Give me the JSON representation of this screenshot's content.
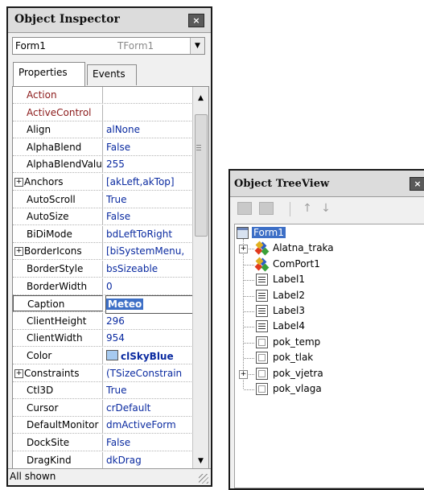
{
  "inspector": {
    "title": "Object Inspector",
    "close_label": "×",
    "object_name": "Form1",
    "object_class": "TForm1",
    "tabs": [
      "Properties",
      "Events"
    ],
    "status": "All shown",
    "properties": [
      {
        "name": "Action",
        "value": "",
        "event": true
      },
      {
        "name": "ActiveControl",
        "value": "",
        "event": true
      },
      {
        "name": "Align",
        "value": "alNone"
      },
      {
        "name": "AlphaBlend",
        "value": "False"
      },
      {
        "name": "AlphaBlendValu",
        "value": "255"
      },
      {
        "name": "Anchors",
        "value": "[akLeft,akTop]",
        "expandable": true
      },
      {
        "name": "AutoScroll",
        "value": "True"
      },
      {
        "name": "AutoSize",
        "value": "False"
      },
      {
        "name": "BiDiMode",
        "value": "bdLeftToRight"
      },
      {
        "name": "BorderIcons",
        "value": "[biSystemMenu,",
        "expandable": true
      },
      {
        "name": "BorderStyle",
        "value": "bsSizeable"
      },
      {
        "name": "BorderWidth",
        "value": "0"
      },
      {
        "name": "Caption",
        "value": "Meteo",
        "selected": true
      },
      {
        "name": "ClientHeight",
        "value": "296"
      },
      {
        "name": "ClientWidth",
        "value": "954"
      },
      {
        "name": "Color",
        "value": "clSkyBlue",
        "swatch": "#a6caf0"
      },
      {
        "name": "Constraints",
        "value": "(TSizeConstrain",
        "expandable": true
      },
      {
        "name": "Ctl3D",
        "value": "True"
      },
      {
        "name": "Cursor",
        "value": "crDefault"
      },
      {
        "name": "DefaultMonitor",
        "value": "dmActiveForm"
      },
      {
        "name": "DockSite",
        "value": "False"
      },
      {
        "name": "DragKind",
        "value": "dkDrag"
      }
    ]
  },
  "treeview": {
    "title": "Object TreeView",
    "close_label": "×",
    "nodes": [
      {
        "label": "Form1",
        "icon": "form-icon",
        "level": 0,
        "selected": true
      },
      {
        "label": "Alatna_traka",
        "icon": "component-icon",
        "level": 1,
        "expander": "+"
      },
      {
        "label": "ComPort1",
        "icon": "component-icon",
        "level": 1
      },
      {
        "label": "Label1",
        "icon": "label-icon",
        "level": 1
      },
      {
        "label": "Label2",
        "icon": "label-icon",
        "level": 1
      },
      {
        "label": "Label3",
        "icon": "label-icon",
        "level": 1
      },
      {
        "label": "Label4",
        "icon": "label-icon",
        "level": 1
      },
      {
        "label": "pok_temp",
        "icon": "panel-icon",
        "level": 1
      },
      {
        "label": "pok_tlak",
        "icon": "panel-icon",
        "level": 1
      },
      {
        "label": "pok_vjetra",
        "icon": "panel-icon",
        "level": 1,
        "expander": "+"
      },
      {
        "label": "pok_vlaga",
        "icon": "panel-icon",
        "level": 1
      }
    ]
  },
  "colors": {
    "selection": "#3d6fc6",
    "value_text": "#0a2aa0",
    "event_text": "#8b1a1a",
    "sky_blue": "#a6caf0"
  }
}
